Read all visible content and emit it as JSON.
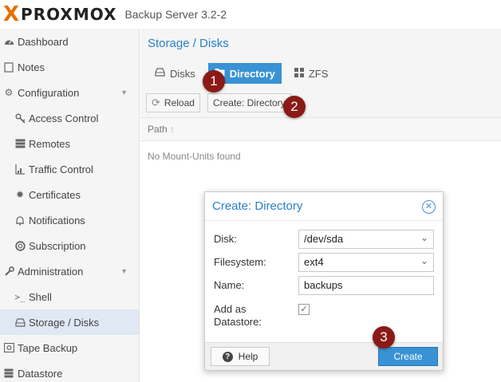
{
  "header": {
    "logo_x": "X",
    "logo_text": "PROXMOX",
    "product": "Backup Server 3.2-2"
  },
  "sidebar": {
    "items": [
      {
        "label": "Dashboard",
        "icon": "dashboard-icon"
      },
      {
        "label": "Notes",
        "icon": "notes-icon"
      },
      {
        "label": "Configuration",
        "icon": "gears-icon"
      },
      {
        "label": "Access Control",
        "icon": "key-icon"
      },
      {
        "label": "Remotes",
        "icon": "server-icon"
      },
      {
        "label": "Traffic Control",
        "icon": "chart-icon"
      },
      {
        "label": "Certificates",
        "icon": "certificate-icon"
      },
      {
        "label": "Notifications",
        "icon": "bell-icon"
      },
      {
        "label": "Subscription",
        "icon": "support-icon"
      },
      {
        "label": "Administration",
        "icon": "wrench-icon"
      },
      {
        "label": "Shell",
        "icon": "terminal-icon"
      },
      {
        "label": "Storage / Disks",
        "icon": "hdd-icon"
      },
      {
        "label": "Tape Backup",
        "icon": "tape-icon"
      },
      {
        "label": "Datastore",
        "icon": "database-icon"
      }
    ],
    "selected": "Storage / Disks"
  },
  "main": {
    "title": "Storage / Disks",
    "tabs": [
      {
        "label": "Disks"
      },
      {
        "label": "Directory"
      },
      {
        "label": "ZFS"
      }
    ],
    "active_tab": "Directory",
    "toolbar": {
      "reload": "Reload",
      "create": "Create: Directory"
    },
    "grid": {
      "column": "Path",
      "sort_indicator": "↑",
      "empty_text": "No Mount-Units found"
    }
  },
  "dialog": {
    "title": "Create: Directory",
    "fields": {
      "disk_label": "Disk:",
      "disk_value": "/dev/sda",
      "fs_label": "Filesystem:",
      "fs_value": "ext4",
      "name_label": "Name:",
      "name_value": "backups",
      "datastore_label_1": "Add as",
      "datastore_label_2": "Datastore:"
    },
    "datastore_checked": true,
    "help": "Help",
    "create": "Create"
  },
  "markers": [
    "1",
    "2",
    "3"
  ],
  "colors": {
    "accent": "#3892d4",
    "title": "#2a80c8",
    "logo_x": "#e57000",
    "marker": "#8b1a16"
  }
}
